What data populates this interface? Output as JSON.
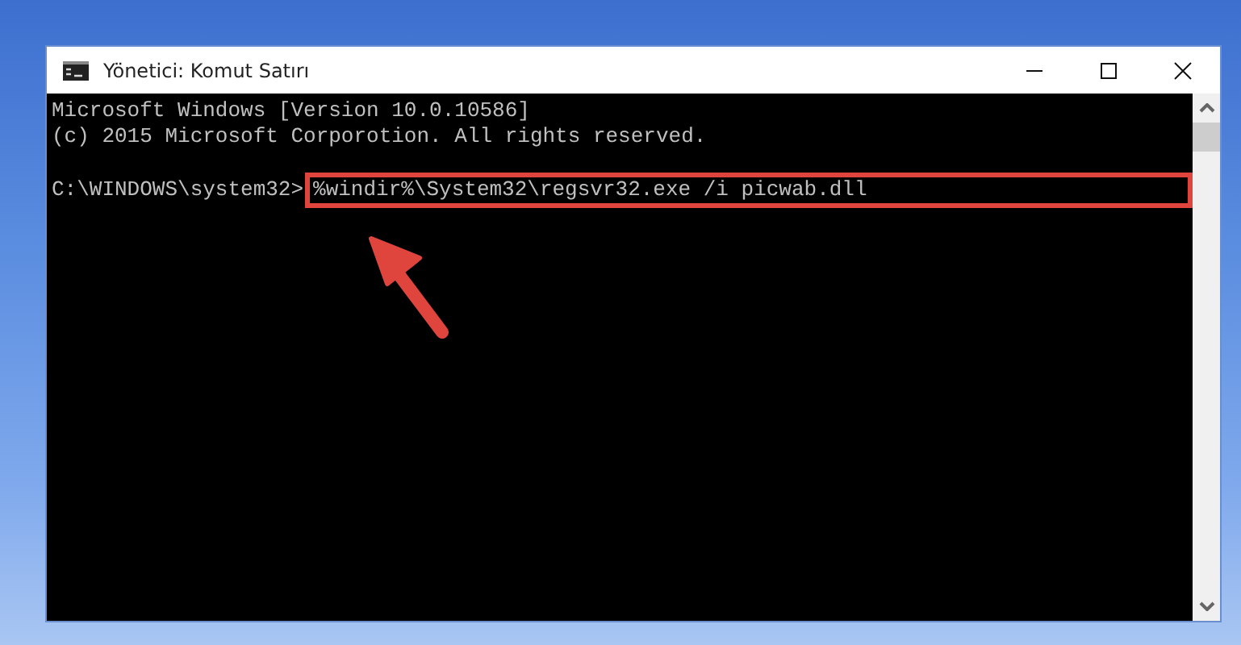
{
  "window": {
    "title": "Yönetici: Komut Satırı"
  },
  "console": {
    "lines": [
      {
        "kind": "text",
        "text": "Microsoft Windows [Version 10.0.10586]"
      },
      {
        "kind": "text",
        "text": "(c) 2015 Microsoft Corporotion. All rights reserved."
      },
      {
        "kind": "blank"
      },
      {
        "kind": "command",
        "prompt": "C:\\WINDOWS\\system32>",
        "text": "%windir%\\System32\\regsvr32.exe /i picwab.dll",
        "highlighted": true
      }
    ]
  }
}
